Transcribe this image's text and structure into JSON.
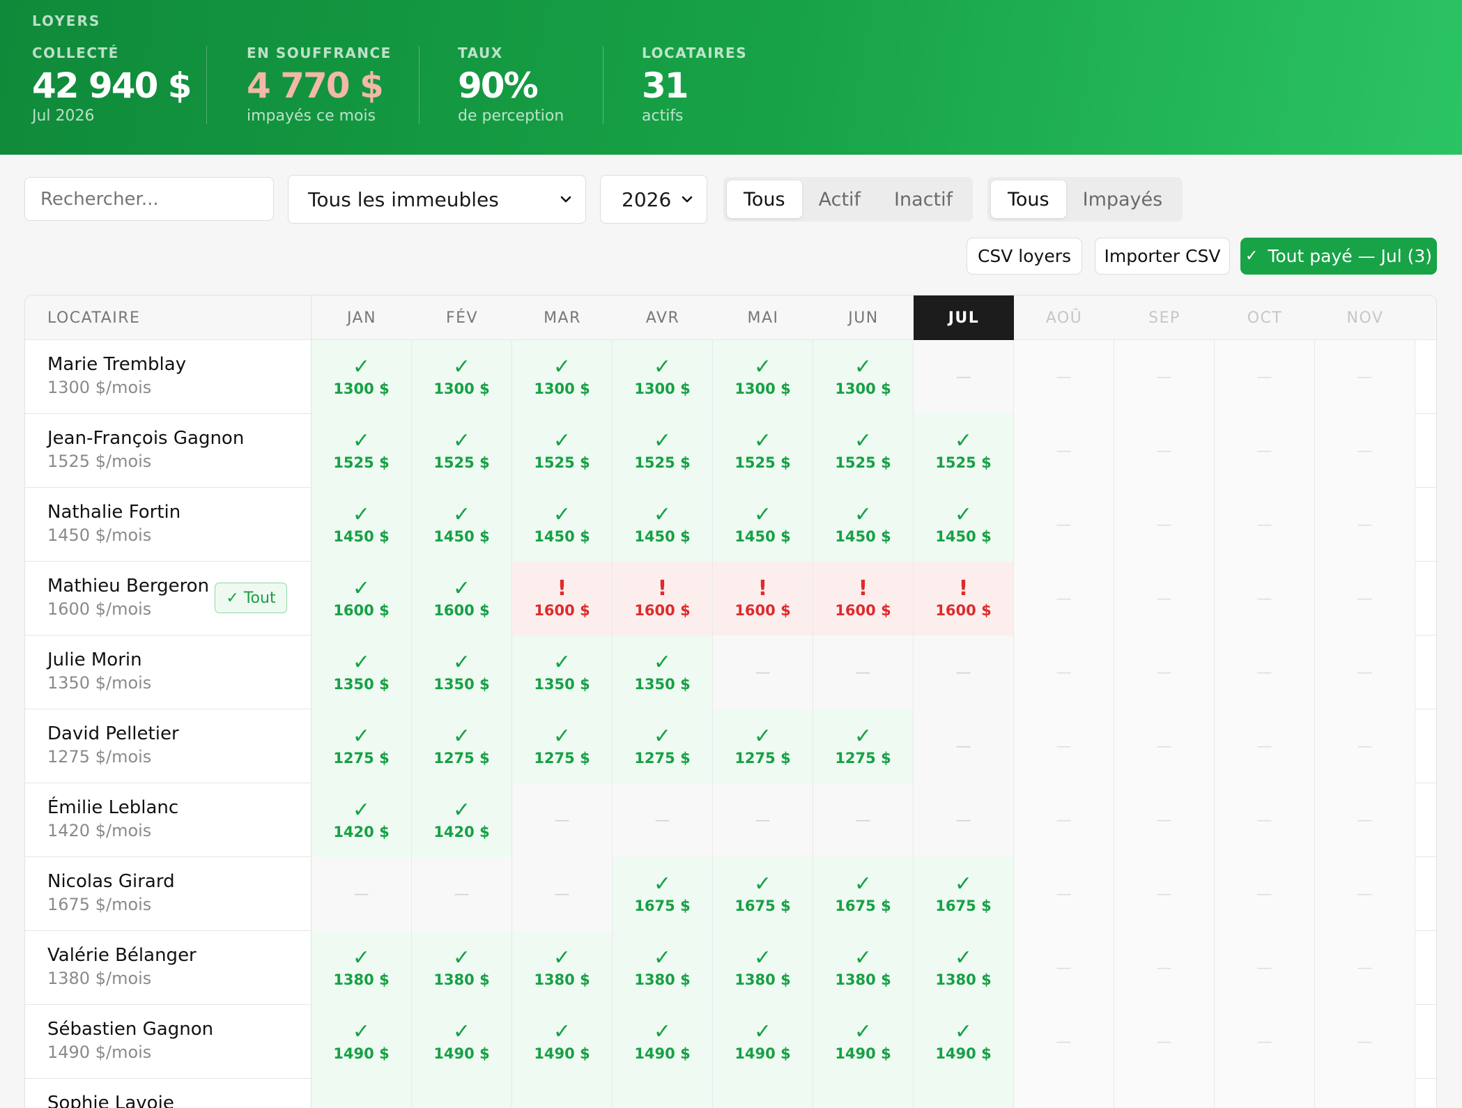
{
  "header": {
    "title": "LOYERS",
    "stats": [
      {
        "label": "COLLECTÉ",
        "value": "42 940 $",
        "sub": "Jul 2026",
        "color": "#ffffff"
      },
      {
        "label": "EN SOUFFRANCE",
        "value": "4 770 $",
        "sub": "impayés ce mois",
        "color": "#f2b8a8"
      },
      {
        "label": "TAUX",
        "value": "90%",
        "sub": "de perception",
        "color": "#ffffff"
      },
      {
        "label": "LOCATAIRES",
        "value": "31",
        "sub": "actifs",
        "color": "#ffffff"
      }
    ]
  },
  "filters": {
    "search_placeholder": "Rechercher...",
    "building_select": "Tous les immeubles",
    "year_select": "2026",
    "status_tabs": [
      "Tous",
      "Actif",
      "Inactif"
    ],
    "status_active": "Tous",
    "payment_tabs": [
      "Tous",
      "Impayés"
    ],
    "payment_active": "Tous"
  },
  "actions": {
    "csv_export": "CSV loyers",
    "csv_import": "Importer CSV",
    "mark_all_paid": "Tout payé — Jul (3)"
  },
  "table": {
    "tenant_header": "LOCATAIRE",
    "months": [
      "JAN",
      "FÉV",
      "MAR",
      "AVR",
      "MAI",
      "JUN",
      "JUL",
      "AOÛ",
      "SEP",
      "OCT",
      "NOV"
    ],
    "current_month_index": 6,
    "paid_mark": "✓",
    "unpaid_mark": "!",
    "empty_mark": "—",
    "row_action_label": "✓ Tout",
    "rows": [
      {
        "name": "Marie Tremblay",
        "rent": "1300 $/mois",
        "amount": "1300 $",
        "status": [
          "p",
          "p",
          "p",
          "p",
          "p",
          "p",
          "e",
          "f",
          "f",
          "f",
          "f"
        ]
      },
      {
        "name": "Jean-François Gagnon",
        "rent": "1525 $/mois",
        "amount": "1525 $",
        "status": [
          "p",
          "p",
          "p",
          "p",
          "p",
          "p",
          "p",
          "f",
          "f",
          "f",
          "f"
        ]
      },
      {
        "name": "Nathalie Fortin",
        "rent": "1450 $/mois",
        "amount": "1450 $",
        "status": [
          "p",
          "p",
          "p",
          "p",
          "p",
          "p",
          "p",
          "f",
          "f",
          "f",
          "f"
        ]
      },
      {
        "name": "Mathieu Bergeron",
        "rent": "1600 $/mois",
        "amount": "1600 $",
        "has_action": true,
        "status": [
          "p",
          "p",
          "u",
          "u",
          "u",
          "u",
          "u",
          "f",
          "f",
          "f",
          "f"
        ]
      },
      {
        "name": "Julie Morin",
        "rent": "1350 $/mois",
        "amount": "1350 $",
        "status": [
          "p",
          "p",
          "p",
          "p",
          "e",
          "e",
          "e",
          "f",
          "f",
          "f",
          "f"
        ]
      },
      {
        "name": "David Pelletier",
        "rent": "1275 $/mois",
        "amount": "1275 $",
        "status": [
          "p",
          "p",
          "p",
          "p",
          "p",
          "p",
          "e",
          "f",
          "f",
          "f",
          "f"
        ]
      },
      {
        "name": "Émilie Leblanc",
        "rent": "1420 $/mois",
        "amount": "1420 $",
        "status": [
          "p",
          "p",
          "e",
          "e",
          "e",
          "e",
          "e",
          "f",
          "f",
          "f",
          "f"
        ]
      },
      {
        "name": "Nicolas Girard",
        "rent": "1675 $/mois",
        "amount": "1675 $",
        "status": [
          "e",
          "e",
          "e",
          "p",
          "p",
          "p",
          "p",
          "f",
          "f",
          "f",
          "f"
        ]
      },
      {
        "name": "Valérie Bélanger",
        "rent": "1380 $/mois",
        "amount": "1380 $",
        "status": [
          "p",
          "p",
          "p",
          "p",
          "p",
          "p",
          "p",
          "f",
          "f",
          "f",
          "f"
        ]
      },
      {
        "name": "Sébastien Gagnon",
        "rent": "1490 $/mois",
        "amount": "1490 $",
        "status": [
          "p",
          "p",
          "p",
          "p",
          "p",
          "p",
          "p",
          "f",
          "f",
          "f",
          "f"
        ]
      },
      {
        "name": "Sophie Lavoie",
        "rent": "",
        "amount": "",
        "status": [
          "p",
          "p",
          "p",
          "p",
          "p",
          "p",
          "p",
          "f",
          "f",
          "f",
          "f"
        ]
      }
    ]
  }
}
